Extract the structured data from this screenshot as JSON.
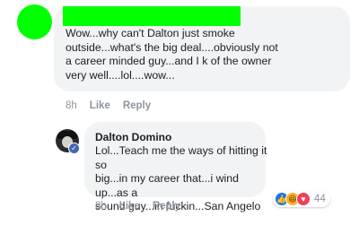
{
  "comment_1": {
    "text": "Wow...why can't Dalton just smoke\noutside...what's the big deal....obviously not\na career minded guy...and I k of the owner\nvery well....lol....wow...",
    "time": "8h",
    "like_label": "Like",
    "reply_label": "Reply"
  },
  "comment_2": {
    "author": "Dalton Domino",
    "text": "Lol...Teach me the ways of hitting it so\nbig...in my career that...i wind up...as a\nsound guy...in fuckin...San Angelo",
    "time": "8h",
    "like_label": "Like",
    "reply_label": "Reply",
    "reactions": {
      "icons": [
        "like-icon",
        "haha-icon",
        "love-icon"
      ],
      "count": "44"
    }
  },
  "colors": {
    "redaction": "#00ff00",
    "bubble": "#f2f3f5",
    "meta": "#8d949e"
  }
}
